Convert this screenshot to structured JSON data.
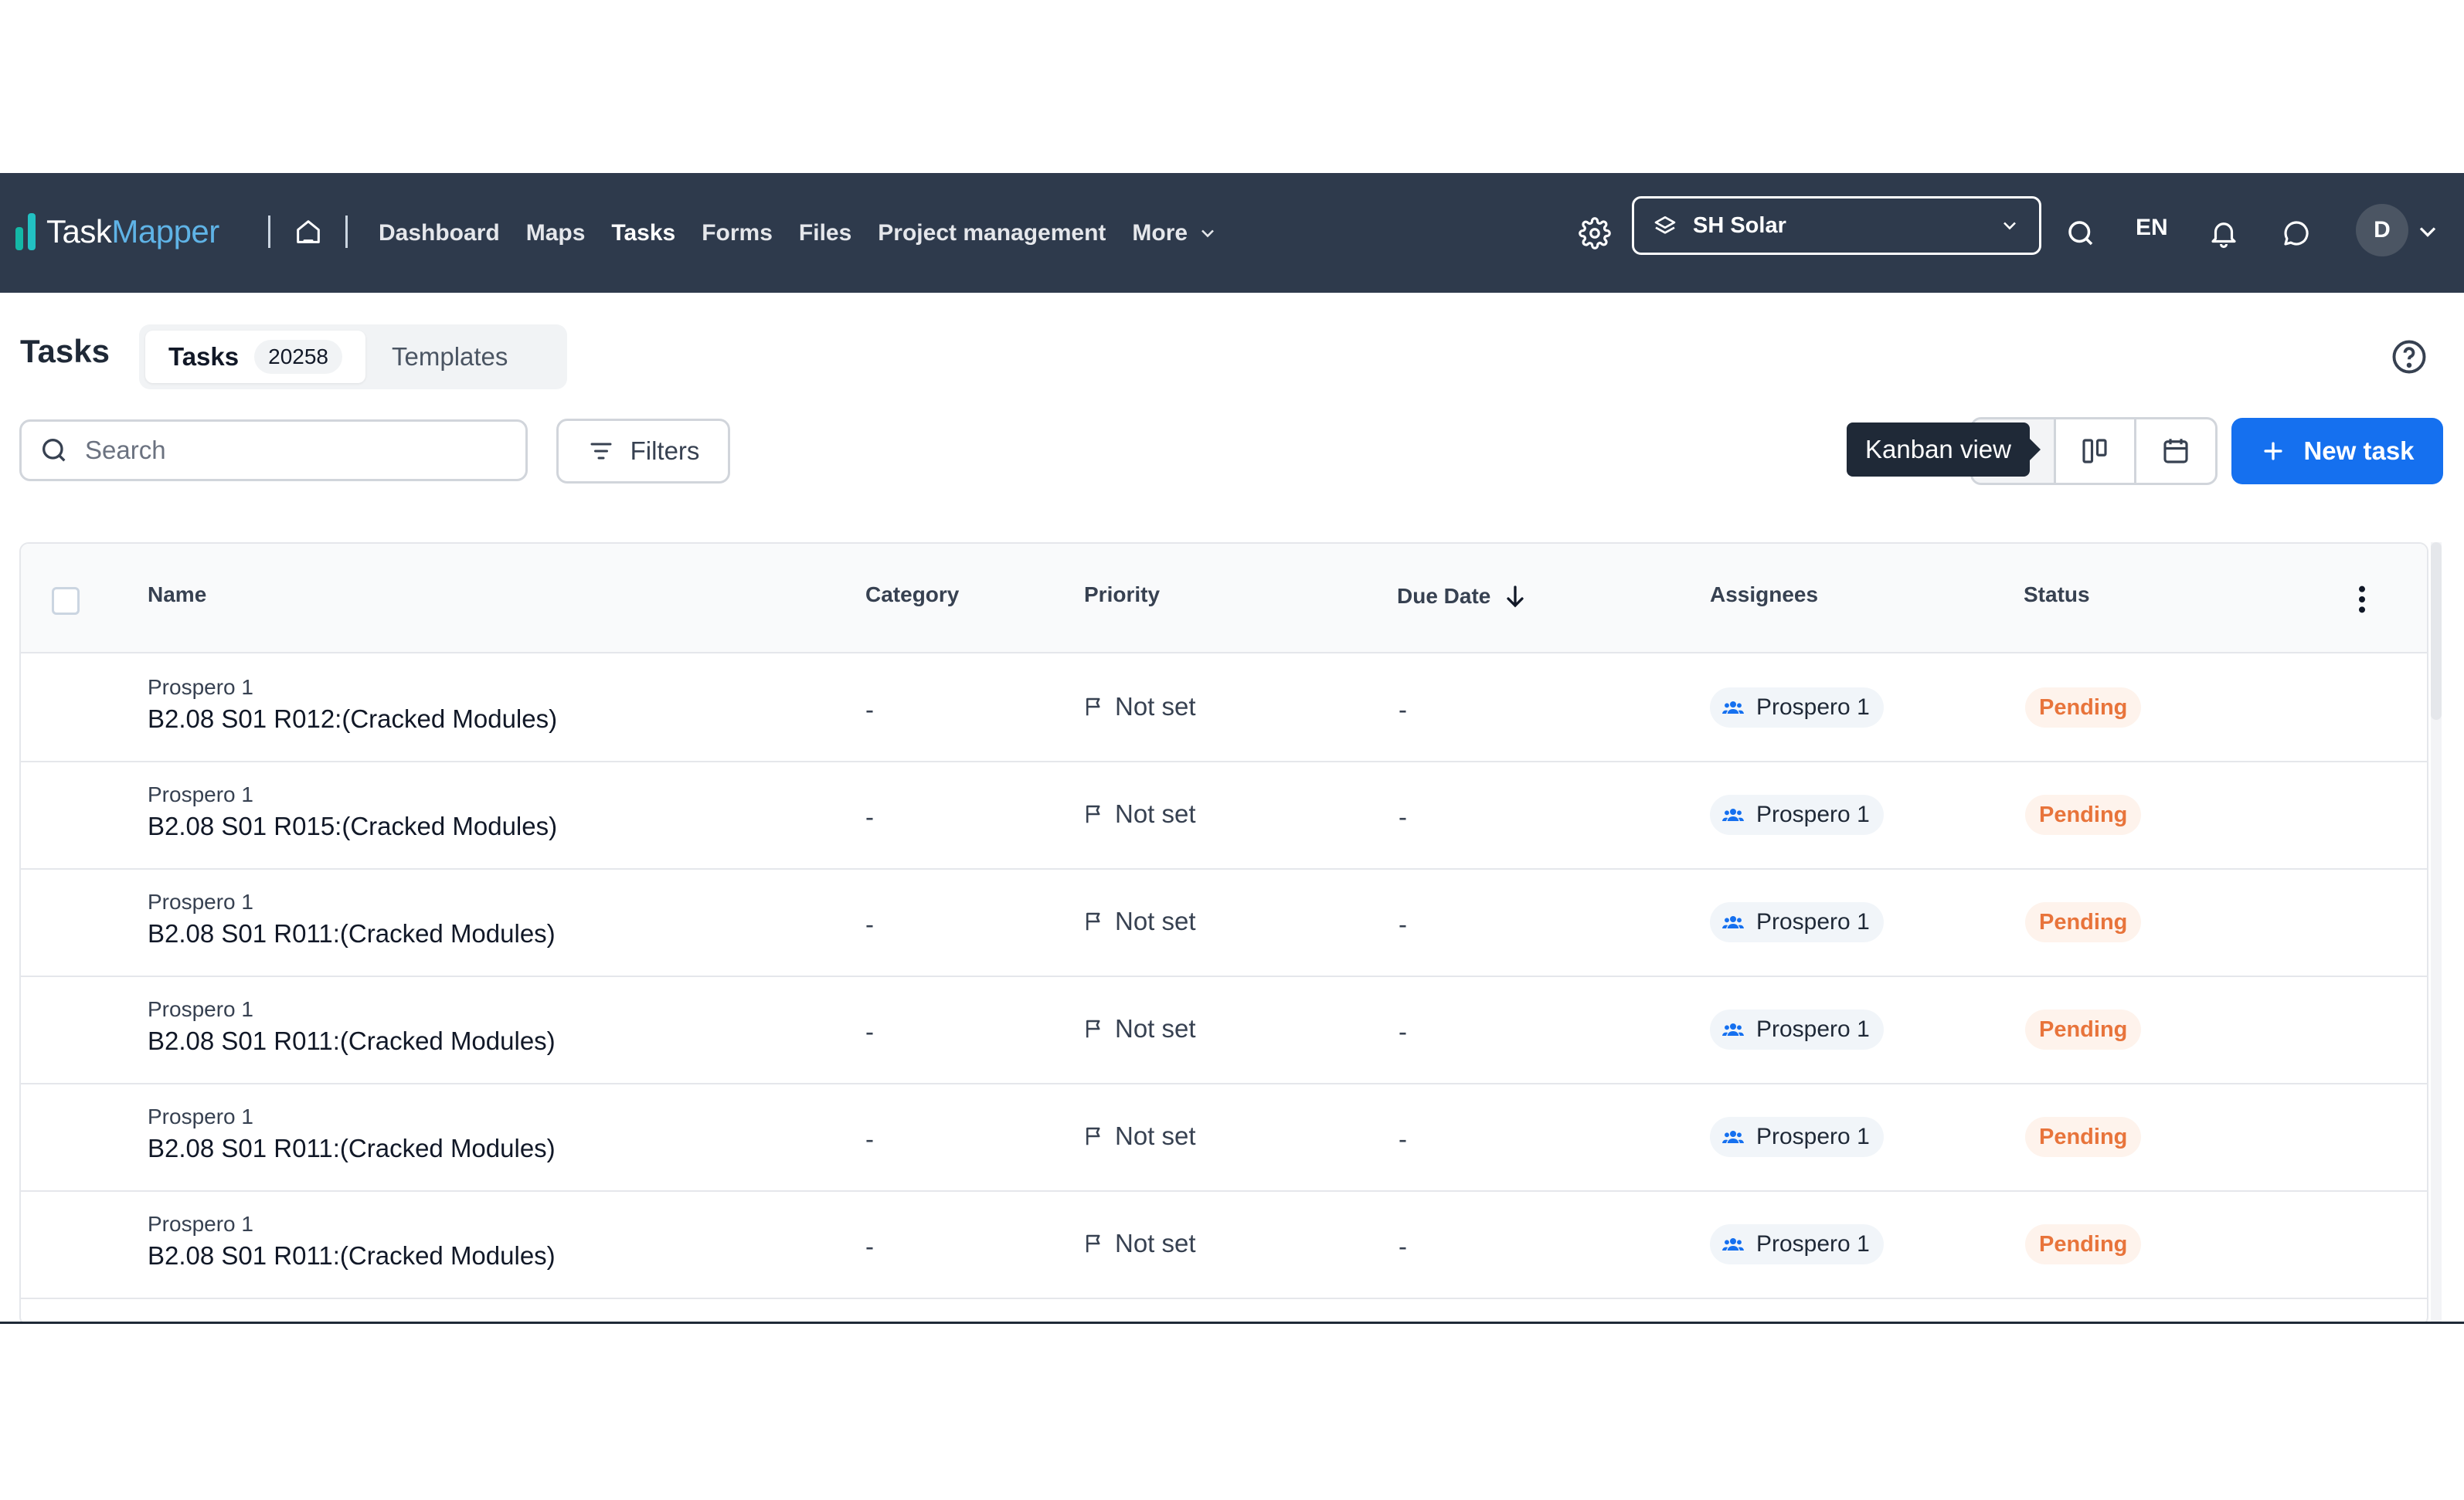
{
  "app": {
    "logo_part1": "Task",
    "logo_part2": "Mapper"
  },
  "nav": {
    "items": [
      {
        "label": "Dashboard"
      },
      {
        "label": "Maps"
      },
      {
        "label": "Tasks",
        "active": true
      },
      {
        "label": "Forms"
      },
      {
        "label": "Files"
      },
      {
        "label": "Project management"
      },
      {
        "label": "More"
      }
    ],
    "workspace": "SH Solar",
    "language": "EN",
    "avatar_initial": "D"
  },
  "header": {
    "title": "Tasks",
    "tabs": [
      {
        "label": "Tasks",
        "count": "20258",
        "active": true
      },
      {
        "label": "Templates"
      }
    ]
  },
  "toolbar": {
    "search_placeholder": "Search",
    "filters_label": "Filters",
    "tooltip": "Kanban view",
    "new_task_label": "New task"
  },
  "table": {
    "columns": [
      "Name",
      "Category",
      "Priority",
      "Due Date",
      "Assignees",
      "Status"
    ],
    "rows": [
      {
        "parent": "Prospero 1",
        "name": "B2.08 S01 R012:(Cracked Modules)",
        "category": "-",
        "priority": "Not set",
        "due": "-",
        "assignee": "Prospero 1",
        "status": "Pending"
      },
      {
        "parent": "Prospero 1",
        "name": "B2.08 S01 R015:(Cracked Modules)",
        "category": "-",
        "priority": "Not set",
        "due": "-",
        "assignee": "Prospero 1",
        "status": "Pending"
      },
      {
        "parent": "Prospero 1",
        "name": "B2.08 S01 R011:(Cracked Modules)",
        "category": "-",
        "priority": "Not set",
        "due": "-",
        "assignee": "Prospero 1",
        "status": "Pending"
      },
      {
        "parent": "Prospero 1",
        "name": "B2.08 S01 R011:(Cracked Modules)",
        "category": "-",
        "priority": "Not set",
        "due": "-",
        "assignee": "Prospero 1",
        "status": "Pending"
      },
      {
        "parent": "Prospero 1",
        "name": "B2.08 S01 R011:(Cracked Modules)",
        "category": "-",
        "priority": "Not set",
        "due": "-",
        "assignee": "Prospero 1",
        "status": "Pending"
      },
      {
        "parent": "Prospero 1",
        "name": "B2.08 S01 R011:(Cracked Modules)",
        "category": "-",
        "priority": "Not set",
        "due": "-",
        "assignee": "Prospero 1",
        "status": "Pending"
      }
    ]
  },
  "colors": {
    "topbar": "#2e3a4c",
    "accent": "#1570ef",
    "status_pending": "#e8743b"
  },
  "icons": [
    "home-icon",
    "chevron-down-icon",
    "gear-icon",
    "layers-icon",
    "search-icon",
    "bell-icon",
    "chat-icon",
    "help-icon",
    "filter-icon",
    "kanban-icon",
    "calendar-icon",
    "plus-icon",
    "sort-desc-icon",
    "more-vertical-icon",
    "flag-icon",
    "group-icon"
  ]
}
